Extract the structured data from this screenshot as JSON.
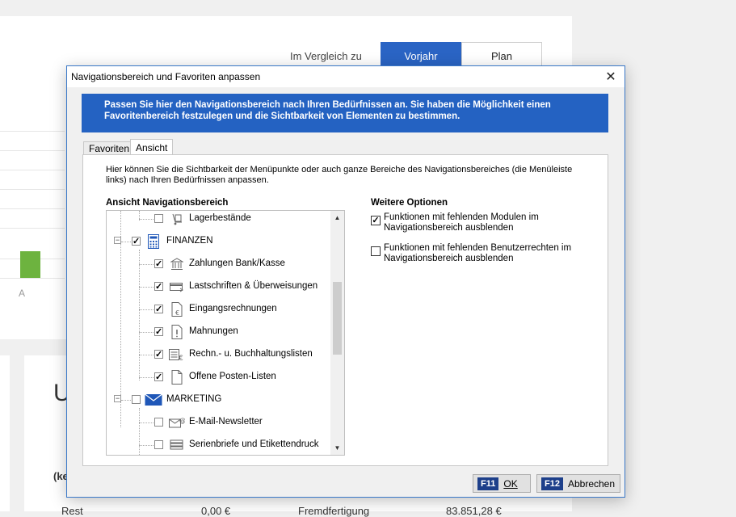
{
  "background": {
    "comparison_label": "Im Vergleich zu",
    "segments": [
      "Vorjahr",
      "Plan"
    ],
    "chart_axis_label": "A",
    "section_letter": "U",
    "subsection_text": "(ke",
    "bottom_row": [
      "Rest",
      "0,00 €",
      "Fremdfertigung",
      "83.851,28 €"
    ]
  },
  "dialog": {
    "title": "Navigationsbereich und Favoriten anpassen",
    "banner": "Passen Sie hier den Navigationsbereich nach Ihren Bedürfnissen an. Sie haben die Möglichkeit einen Favoritenbereich festzulegen und die Sichtbarkeit von Elementen zu bestimmen.",
    "tabs": [
      "Favoriten",
      "Ansicht"
    ],
    "active_tab": "Ansicht",
    "intro": "Hier können Sie die Sichtbarkeit der Menüpunkte oder auch ganze Bereiche des Navigationsbereiches (die Menüleiste links) nach Ihren Bedürfnissen anpassen.",
    "tree_title": "Ansicht Navigationsbereich",
    "tree_items": [
      {
        "label": "Lagerbestände",
        "checked": false,
        "level": 2,
        "icon": "hand-truck-icon"
      },
      {
        "label": "FINANZEN",
        "checked": true,
        "level": 1,
        "icon": "calculator-icon"
      },
      {
        "label": "Zahlungen Bank/Kasse",
        "checked": true,
        "level": 2,
        "icon": "bank-icon"
      },
      {
        "label": "Lastschriften & Überweisungen",
        "checked": true,
        "level": 2,
        "icon": "card-icon"
      },
      {
        "label": "Eingangsrechnungen",
        "checked": true,
        "level": 2,
        "icon": "invoice-icon"
      },
      {
        "label": "Mahnungen",
        "checked": true,
        "level": 2,
        "icon": "reminder-icon"
      },
      {
        "label": "Rechn.- u. Buchhaltungslisten",
        "checked": true,
        "level": 2,
        "icon": "ledger-icon"
      },
      {
        "label": "Offene Posten-Listen",
        "checked": true,
        "level": 2,
        "icon": "document-icon"
      },
      {
        "label": "MARKETING",
        "checked": false,
        "level": 1,
        "icon": "envelope-icon"
      },
      {
        "label": "E-Mail-Newsletter",
        "checked": false,
        "level": 2,
        "icon": "email-icon"
      },
      {
        "label": "Serienbriefe und Etikettendruck",
        "checked": false,
        "level": 2,
        "icon": "stack-icon"
      }
    ],
    "options_title": "Weitere Optionen",
    "options": [
      {
        "label": "Funktionen mit fehlenden Modulen im Navigationsbereich ausblenden",
        "checked": true
      },
      {
        "label": "Funktionen mit fehlenden Benutzerrechten im Navigationsbereich ausblenden",
        "checked": false
      }
    ],
    "ok_key": "F11",
    "ok_label": "OK",
    "cancel_key": "F12",
    "cancel_label": "Abbrechen"
  }
}
